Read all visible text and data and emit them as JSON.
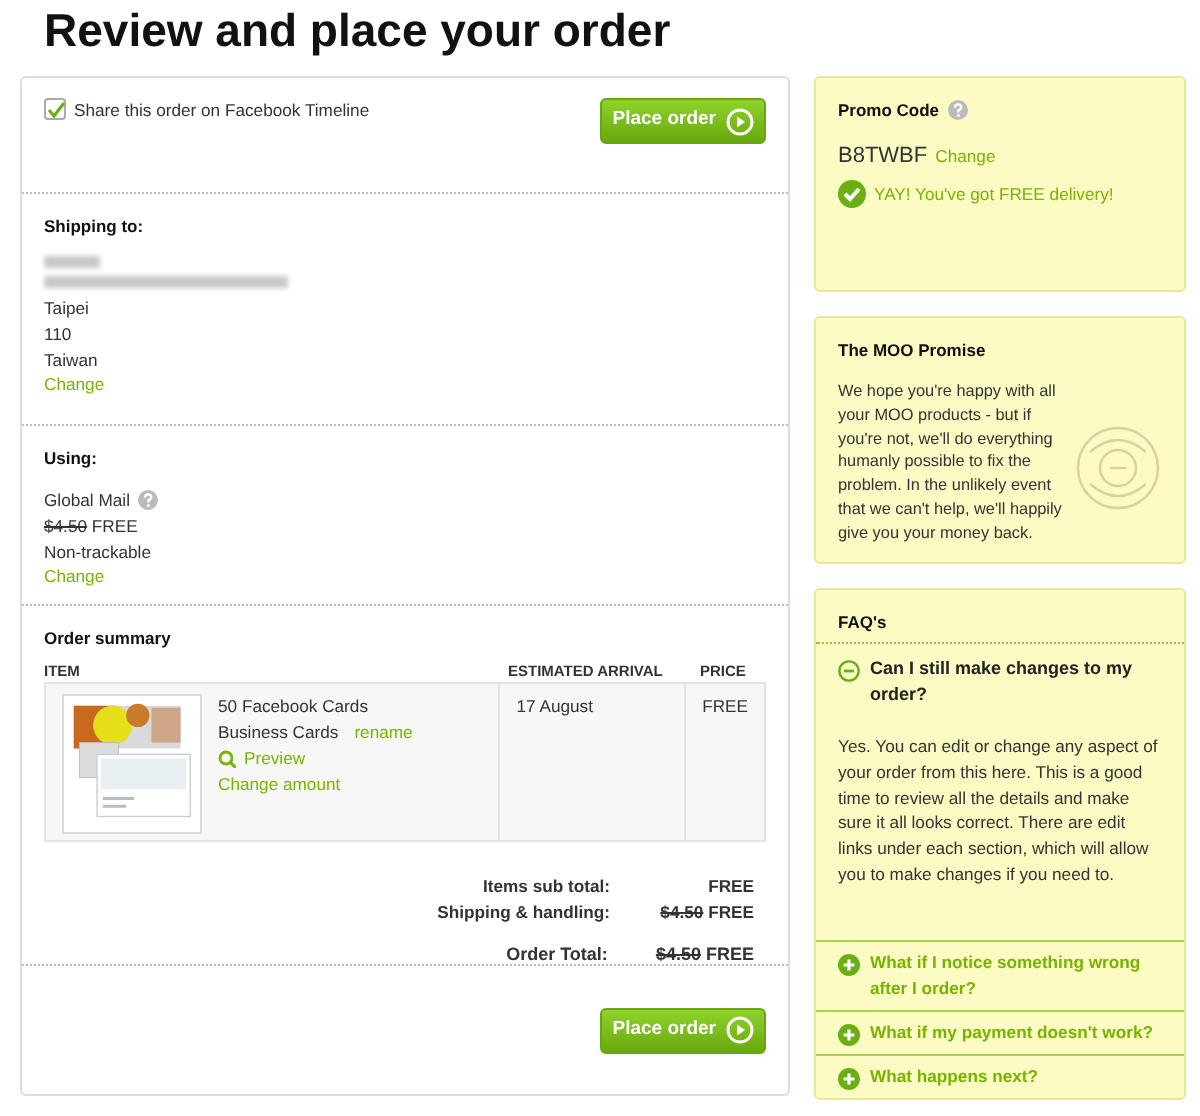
{
  "title": "Review and place your order",
  "share": {
    "label": "Share this order on Facebook Timeline",
    "checked": true
  },
  "top_button": "Place order",
  "shipping": {
    "heading": "Shipping to:",
    "address_lines": [
      "Taipei",
      "110",
      "Taiwan"
    ],
    "change": "Change"
  },
  "using": {
    "heading": "Using:",
    "method": "Global Mail",
    "old_price": "$4.50",
    "price": "FREE",
    "tracking": "Non-trackable",
    "change": "Change"
  },
  "order_summary": {
    "heading": "Order summary",
    "columns": [
      "ITEM",
      "ESTIMATED ARRIVAL",
      "PRICE"
    ],
    "items": [
      {
        "title": "50 Facebook Cards",
        "type": "Business Cards",
        "rename": "rename",
        "preview": "Preview",
        "change_amount": "Change amount",
        "arrival": "17 August",
        "price": "FREE"
      }
    ],
    "totals": [
      {
        "label": "Items sub total:",
        "value": "FREE"
      },
      {
        "label": "Shipping & handling:",
        "old_price": "$4.50",
        "value": "FREE"
      },
      {
        "label": "Order Total:",
        "old_price": "$4.50",
        "value": "FREE"
      }
    ]
  },
  "bottom_button": "Place order",
  "promo": {
    "heading": "Promo Code",
    "code": "B8TWBF",
    "change": "Change",
    "message": "YAY! You've got FREE delivery!"
  },
  "promise": {
    "heading": "The MOO Promise",
    "text": "We hope you're happy with all your MOO products - but if you're not, we'll do everything humanly possible to fix the problem. In the unlikely event that we can't help, we'll happily give you your money back."
  },
  "faq": {
    "heading": "FAQ's",
    "items": [
      {
        "question": "Can I still make changes to my order?",
        "expanded": true,
        "answer": "Yes. You can edit or change any aspect of your order from this here. This is a good time to review all the details and make sure it all looks correct. There are edit links under each section, which will allow you to make changes if you need to."
      },
      {
        "question": "What if I notice something wrong after I order?",
        "expanded": false
      },
      {
        "question": "What if my payment doesn't work?",
        "expanded": false
      },
      {
        "question": "What happens next?",
        "expanded": false
      }
    ]
  }
}
